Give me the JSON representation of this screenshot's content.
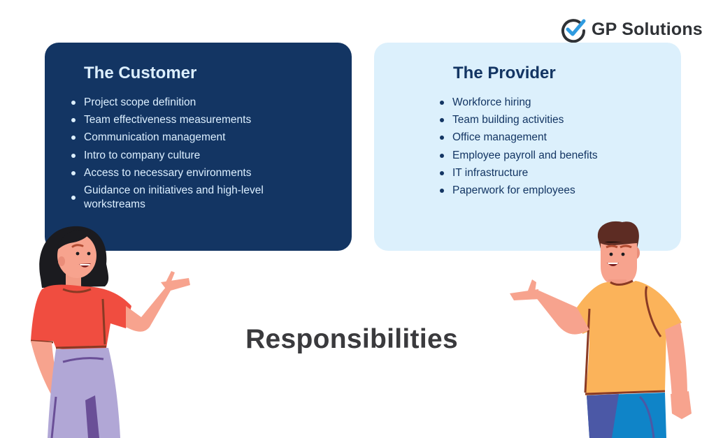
{
  "brand": {
    "name": "GP Solutions",
    "logo_icon": "check-circle-icon",
    "colors": {
      "check": "#2f9be0",
      "ring": "#2f3236"
    }
  },
  "customer": {
    "title": "The Customer",
    "items": [
      "Project scope definition",
      "Team effectiveness measurements",
      "Communication management",
      "Intro to company culture",
      "Access to necessary environments",
      "Guidance on initiatives and high-level workstreams"
    ],
    "colors": {
      "background": "#133563",
      "text": "#dcefff"
    }
  },
  "provider": {
    "title": "The Provider",
    "items": [
      "Workforce hiring",
      "Team building activities",
      "Office management",
      "Employee payroll and benefits",
      "IT infrastructure",
      "Paperwork for employees"
    ],
    "colors": {
      "background": "#dcf0fc",
      "text": "#133563"
    }
  },
  "headline": "Responsibilities",
  "illustrations": {
    "left": "woman-presenting-illustration",
    "right": "man-presenting-illustration"
  }
}
